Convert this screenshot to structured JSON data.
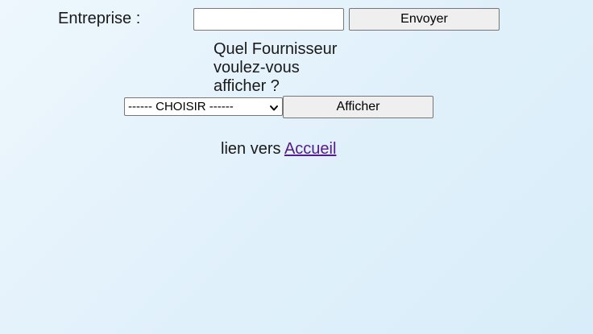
{
  "form_entreprise": {
    "label": "Entreprise :",
    "input_value": "",
    "submit_label": "Envoyer"
  },
  "form_fournisseur": {
    "question": "Quel Fournisseur voulez-vous afficher ?",
    "select_value": "------ CHOISIR ------",
    "submit_label": "Afficher"
  },
  "footer_link": {
    "prefix": "lien vers",
    "link_label": "Accueil"
  },
  "colors": {
    "link_visited": "#551a8b",
    "background_start": "#eef7fd",
    "background_end": "#d8edf9"
  }
}
